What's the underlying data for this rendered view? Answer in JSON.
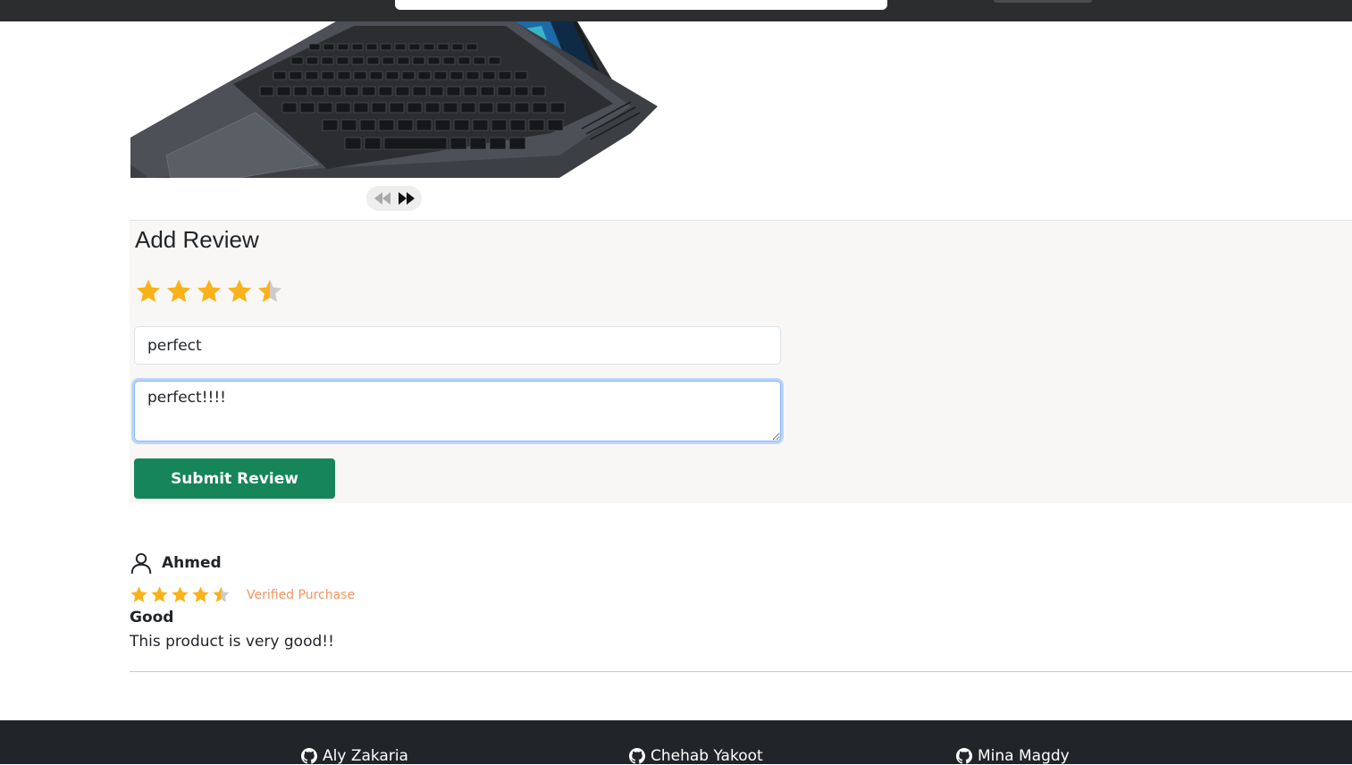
{
  "product": {
    "image_alt": "laptop product image",
    "carousel": {
      "prev_icon": "rewind-icon",
      "next_icon": "fast-forward-icon"
    }
  },
  "review_form": {
    "title": "Add Review",
    "rating": 4.5,
    "rating_max": 5,
    "title_value": "perfect",
    "body_value": "perfect!!!!",
    "submit_label": "Submit Review"
  },
  "reviews": [
    {
      "name": "Ahmed",
      "rating": 4.5,
      "verified_label": "Verified Purchase",
      "title": "Good",
      "body": "This product is very good!!"
    }
  ],
  "footer": {
    "links": [
      {
        "label": "Aly Zakaria",
        "icon": "github-icon"
      },
      {
        "label": "Chehab Yakoot",
        "icon": "github-icon"
      },
      {
        "label": "Mina Magdy",
        "icon": "github-icon"
      }
    ]
  },
  "colors": {
    "star": "#fbb118",
    "star_empty": "#cccccc",
    "submit": "#16855a",
    "verified": "#f0955f",
    "footer_bg": "#212529"
  }
}
